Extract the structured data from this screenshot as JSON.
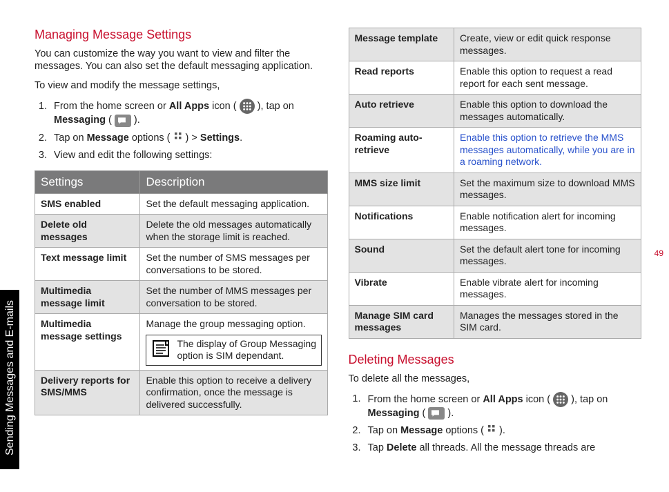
{
  "sideTab": "Sending Messages and E-mails",
  "pageNumber": "49",
  "left": {
    "heading": "Managing Message Settings",
    "intro1": "You can customize the way you want to view and filter the messages. You can also set the default messaging application.",
    "intro2": "To view and modify the message settings,",
    "step1a": "From the home screen or ",
    "step1b": "All Apps",
    "step1c": " icon ( ",
    "step1d": " ), tap on ",
    "step1e": "Messaging",
    "step1f": " ( ",
    "step1g": " ).",
    "step2a": "Tap on ",
    "step2b": "Message",
    "step2c": " options ( ",
    "step2d": " ) > ",
    "step2e": "Settings",
    "step2f": ".",
    "step3": "View and edit the following settings:",
    "table": {
      "h1": "Settings",
      "h2": "Description",
      "rows": [
        {
          "k": "SMS enabled",
          "v": "Set the default messaging application."
        },
        {
          "k": "Delete old messages",
          "v": "Delete the old messages automatically when the storage limit is reached."
        },
        {
          "k": "Text message limit",
          "v": "Set the number of SMS messages per conversations to be stored."
        },
        {
          "k": "Multimedia message limit",
          "v": "Set the number of MMS messages per conversation to be stored."
        },
        {
          "k": "Multimedia message settings",
          "v": "Manage the group messaging option.",
          "note": "The display of Group Messaging option is SIM dependant."
        },
        {
          "k": "Delivery reports for SMS/MMS",
          "v": "Enable this option to receive a delivery confirmation, once the message is delivered successfully."
        }
      ]
    }
  },
  "right": {
    "table": {
      "rows": [
        {
          "k": "Message template",
          "v": "Create, view or edit quick response messages."
        },
        {
          "k": "Read reports",
          "v": "Enable this option to request a read report for each sent message."
        },
        {
          "k": "Auto retrieve",
          "v": "Enable this option to download the messages automatically."
        },
        {
          "k": "Roaming auto-retrieve",
          "v": "Enable this option to retrieve the MMS messages automatically, while you are in a roaming network.",
          "link": true
        },
        {
          "k": "MMS size limit",
          "v": "Set the maximum size to download MMS messages."
        },
        {
          "k": "Notifications",
          "v": "Enable notification alert for incoming messages."
        },
        {
          "k": "Sound",
          "v": "Set the default alert tone for incoming messages."
        },
        {
          "k": "Vibrate",
          "v": "Enable vibrate alert for incoming messages."
        },
        {
          "k": "Manage SIM card messages",
          "v": "Manages the messages stored in the SIM card."
        }
      ]
    },
    "heading2": "Deleting Messages",
    "intro3": "To delete all the messages,",
    "d1a": "From the home screen or ",
    "d1b": "All Apps",
    "d1c": " icon ( ",
    "d1d": " ), tap on ",
    "d1e": "Messaging",
    "d1f": " ( ",
    "d1g": " ).",
    "d2a": "Tap on ",
    "d2b": "Message",
    "d2c": " options ( ",
    "d2d": " ).",
    "d3a": "Tap ",
    "d3b": "Delete",
    "d3c": " all threads. All the message threads are"
  }
}
